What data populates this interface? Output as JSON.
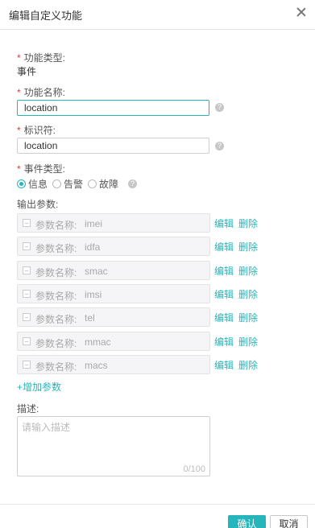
{
  "dialog": {
    "title": "编辑自定义功能",
    "close_icon": "close-icon"
  },
  "form": {
    "function_type": {
      "label": "功能类型:",
      "value": "事件"
    },
    "function_name": {
      "label": "功能名称:",
      "value": "location"
    },
    "identifier": {
      "label": "标识符:",
      "value": "location"
    },
    "event_type": {
      "label": "事件类型:",
      "options": [
        "信息",
        "告警",
        "故障"
      ],
      "selected": "信息"
    },
    "output_params": {
      "label": "输出参数:",
      "name_label": "参数名称:",
      "edit_label": "编辑",
      "delete_label": "删除",
      "items": [
        "imei",
        "idfa",
        "smac",
        "imsi",
        "tel",
        "mmac",
        "macs"
      ],
      "add_label": "+增加参数"
    },
    "description": {
      "label": "描述:",
      "placeholder": "请输入描述",
      "counter": "0/100"
    }
  },
  "footer": {
    "ok_label": "确认",
    "cancel_label": "取消"
  },
  "colors": {
    "accent": "#25b5ba",
    "required": "#e4393c"
  }
}
